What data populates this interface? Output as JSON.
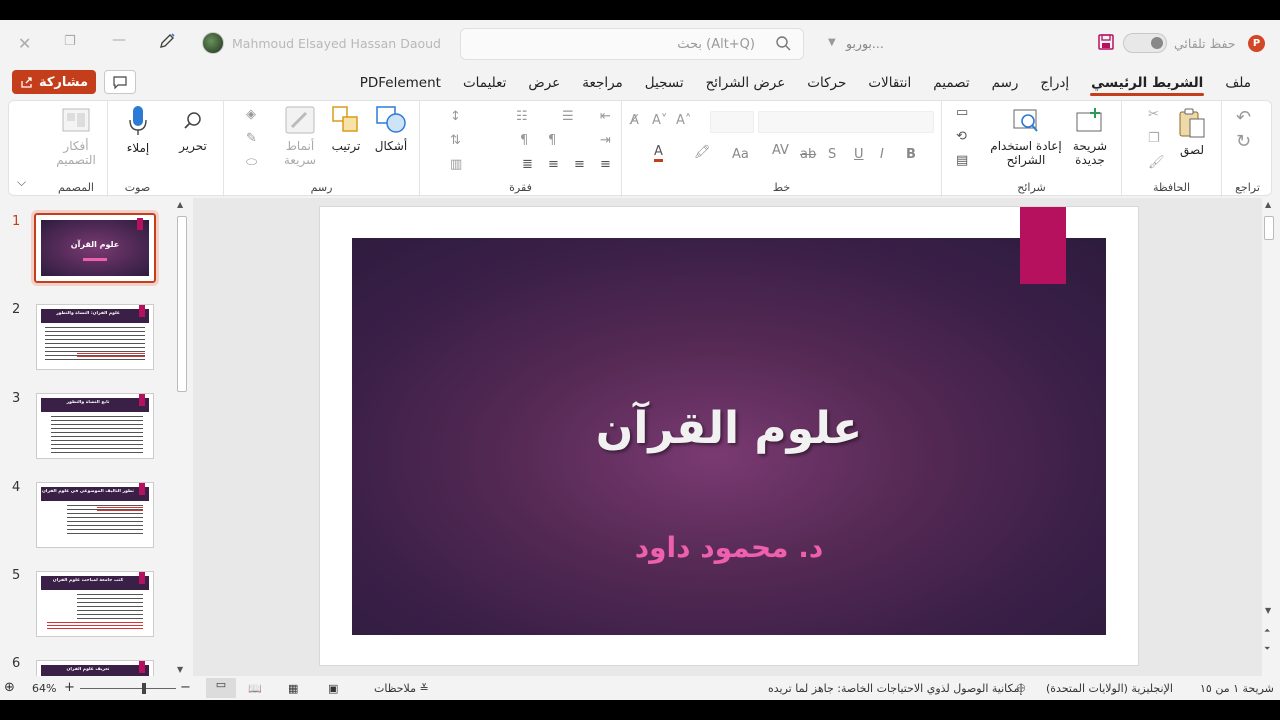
{
  "titlebar": {
    "autosave_label": "حفظ تلقائي",
    "file_name": "بوربو...",
    "search_placeholder": "بحث (Alt+Q)",
    "user_name": "Mahmoud Elsayed Hassan Daoud"
  },
  "menubar": {
    "share_label": "مشاركة",
    "tabs": [
      {
        "label": "ملف"
      },
      {
        "label": "الشريط الرئيسي"
      },
      {
        "label": "إدراج"
      },
      {
        "label": "رسم"
      },
      {
        "label": "تصميم"
      },
      {
        "label": "انتقالات"
      },
      {
        "label": "حركات"
      },
      {
        "label": "عرض الشرائح"
      },
      {
        "label": "تسجيل"
      },
      {
        "label": "مراجعة"
      },
      {
        "label": "عرض"
      },
      {
        "label": "تعليمات"
      },
      {
        "label": "PDFelement"
      }
    ]
  },
  "ribbon": {
    "groups": {
      "undo": "تراجع",
      "clipboard": "الحافظة",
      "slides": "شرائح",
      "font": "خط",
      "paragraph": "فقرة",
      "drawing": "رسم",
      "voice": "صوت",
      "designer": "المصمم"
    },
    "buttons": {
      "paste": "لصق",
      "new_slide_1": "شريحة",
      "new_slide_2": "جديدة",
      "reuse_1": "إعادة استخدام",
      "reuse_2": "الشرائح",
      "shapes": "أشكال",
      "arrange": "ترتيب",
      "quick_styles_1": "أنماط",
      "quick_styles_2": "سريعة",
      "editing": "تحرير",
      "dictate": "إملاء",
      "designer_1": "أفكار",
      "designer_2": "التصميم"
    }
  },
  "slides_pane": {
    "thumbs": [
      {
        "num": "1",
        "title": "علوم القرآن"
      },
      {
        "num": "2",
        "title": "علوم القرآن: النشأة والتطور"
      },
      {
        "num": "3",
        "title": "تابع النشأة والتطور"
      },
      {
        "num": "4",
        "title": "تطور التأليف الموضوعي في علوم القرآن"
      },
      {
        "num": "5",
        "title": "كتب جامعة لمباحث علوم القرآن"
      },
      {
        "num": "6",
        "title": "تعريف علوم القرآن"
      }
    ]
  },
  "slide": {
    "title": "علوم القرآن",
    "subtitle": "د. محمود داود"
  },
  "statusbar": {
    "slide_count": "شريحة ١ من ١٥",
    "language": "الإنجليزية (الولايات المتحدة)",
    "accessibility": "إمكانية الوصول لذوي الاحتياجات الخاصة: جاهز لما تريده",
    "notes": "ملاحظات",
    "zoom": "64%"
  },
  "colors": {
    "accent": "#c43e1c",
    "slide_tag": "#b5115f",
    "subtitle": "#ee5fae"
  }
}
